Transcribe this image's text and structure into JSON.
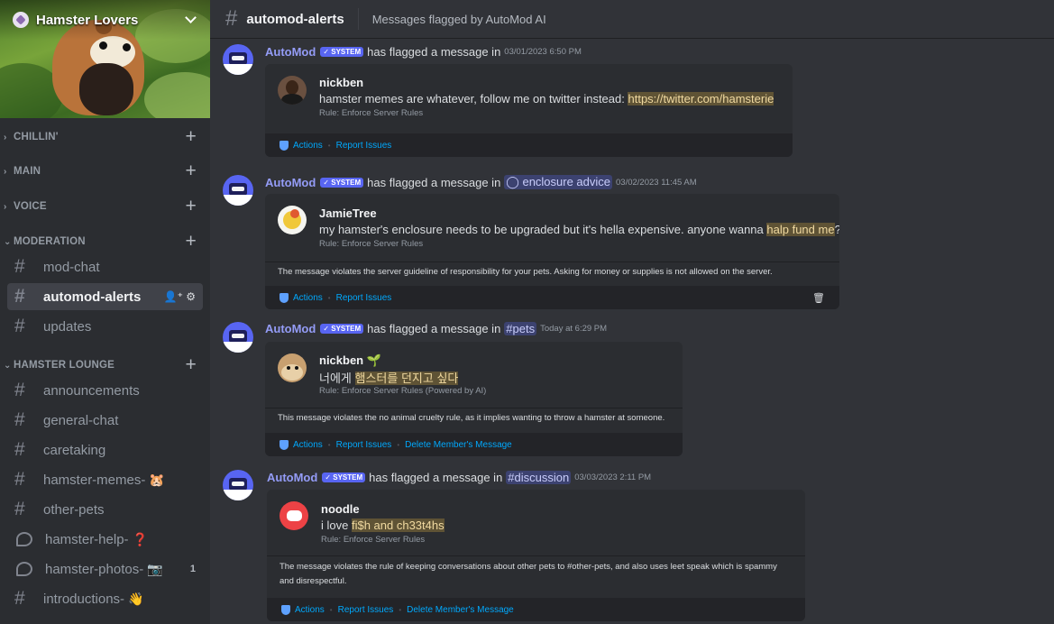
{
  "server": {
    "name": "Hamster Lovers"
  },
  "categories": [
    {
      "label": "CHILLIN'",
      "arrow": "›",
      "plus": "+"
    },
    {
      "label": "MAIN",
      "arrow": "›",
      "plus": "+"
    },
    {
      "label": "VOICE",
      "arrow": "›",
      "plus": "+"
    },
    {
      "label": "MODERATION",
      "arrow": "⌄",
      "plus": "+"
    },
    {
      "label": "HAMSTER LOUNGE",
      "arrow": "⌄",
      "plus": "+"
    }
  ],
  "channels": {
    "mod_chat": "mod-chat",
    "automod_alerts": "automod-alerts",
    "updates": "updates",
    "announcements": "announcements",
    "general_chat": "general-chat",
    "caretaking": "caretaking",
    "hamster_memes": "hamster-memes-",
    "hamster_memes_emoji": "🐹",
    "other_pets": "other-pets",
    "hamster_help": "hamster-help-",
    "hamster_help_emoji": "❓",
    "hamster_photos": "hamster-photos-",
    "hamster_photos_emoji": "📷",
    "hamster_photos_count": "1",
    "introductions": "introductions-",
    "introductions_emoji": "👋"
  },
  "topbar": {
    "hash": "#",
    "title": "automod-alerts",
    "topic": "Messages flagged by AutoMod AI"
  },
  "common": {
    "bot": "AutoMod",
    "tag": "✓ SYSTEM",
    "flagged": "has flagged a message in",
    "actions": "Actions",
    "report": "Report Issues",
    "delete": "Delete Member's Message"
  },
  "messages": [
    {
      "channel": "",
      "ts": "03/01/2023 6:50 PM",
      "user": "nickben",
      "text_before": "hamster memes are whatever, follow me on twitter instead: ",
      "text_hl": "https://twitter.com/hamsterie",
      "text_after": "",
      "rule": "Rule: Enforce Server Rules",
      "explanation": ""
    },
    {
      "channel": "◯ enclosure advice",
      "ts": "03/02/2023 11:45 AM",
      "user": "JamieTree",
      "text_before": "my hamster's enclosure needs to be upgraded but it's hella expensive. anyone wanna ",
      "text_hl": "halp fund me",
      "text_after": "?",
      "rule": "Rule: Enforce Server Rules",
      "explanation": "The message violates the server guideline of responsibility for your pets. Asking for money or supplies is not allowed on the server."
    },
    {
      "channel": "#pets",
      "ts": "Today at 6:29 PM",
      "user": "nickben",
      "user_badge": "🌱",
      "text_before": "너에게 ",
      "text_hl": "햄스터를 던지고 싶다",
      "text_after": "",
      "rule": "Rule: Enforce Server Rules (Powered by AI)",
      "explanation": "This message violates the no animal cruelty rule, as it implies wanting to throw a hamster at someone."
    },
    {
      "channel": "#discussion",
      "ts": "03/03/2023 2:11 PM",
      "user": "noodle",
      "text_before": "i love ",
      "text_hl": "fi$h and ch33t4hs",
      "text_after": "",
      "rule": "Rule: Enforce Server Rules",
      "explanation": "The message violates the rule of keeping conversations about other pets to #other-pets, and also uses leet speak which is spammy and disrespectful."
    }
  ]
}
